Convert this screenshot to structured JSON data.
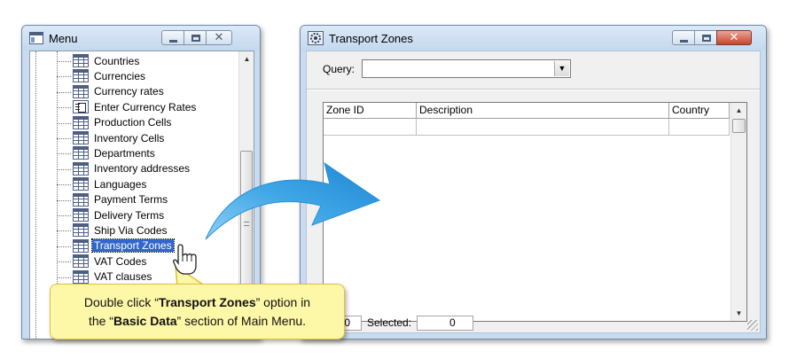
{
  "menu_window": {
    "title": "Menu",
    "items": [
      {
        "label": "Countries",
        "icon": "table-icon"
      },
      {
        "label": "Currencies",
        "icon": "table-icon"
      },
      {
        "label": "Currency rates",
        "icon": "table-icon"
      },
      {
        "label": "Enter Currency Rates",
        "icon": "form-icon"
      },
      {
        "label": "Production Cells",
        "icon": "table-icon"
      },
      {
        "label": "Inventory Cells",
        "icon": "table-icon"
      },
      {
        "label": "Departments",
        "icon": "table-icon"
      },
      {
        "label": "Inventory addresses",
        "icon": "table-icon"
      },
      {
        "label": "Languages",
        "icon": "table-icon"
      },
      {
        "label": "Payment Terms",
        "icon": "table-icon"
      },
      {
        "label": "Delivery Terms",
        "icon": "table-icon"
      },
      {
        "label": "Ship Via Codes",
        "icon": "table-icon"
      },
      {
        "label": "Transport Zones",
        "icon": "table-icon",
        "selected": true
      },
      {
        "label": "VAT Codes",
        "icon": "table-icon"
      },
      {
        "label": "VAT clauses",
        "icon": "table-icon"
      }
    ]
  },
  "transport_window": {
    "title": "Transport Zones",
    "query_label": "Query:",
    "query_value": "",
    "columns": [
      "Zone ID",
      "Description",
      "Country"
    ],
    "status": {
      "count_value": "0",
      "selected_label": "Selected:",
      "selected_value": "0"
    }
  },
  "callout": {
    "line1_prefix": "Double click “",
    "line1_bold": "Transport Zones",
    "line1_suffix": "” option in",
    "line2_prefix": "the “",
    "line2_bold": "Basic Data",
    "line2_suffix": "” section of Main Menu."
  },
  "colors": {
    "arrow": "#3fa6e6",
    "callout_bg": "#fdf7a8",
    "selection": "#3366cc",
    "close_button": "#c7442d"
  }
}
